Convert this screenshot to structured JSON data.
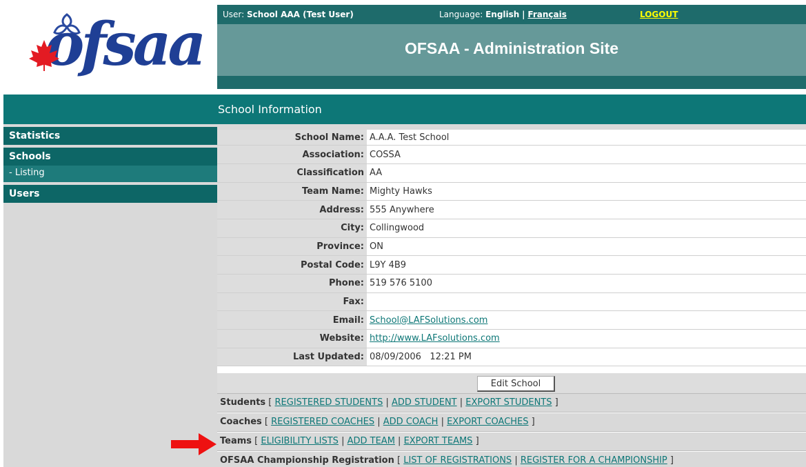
{
  "header": {
    "user_label": "User:",
    "user_name": "School AAA (Test User)",
    "language_label": "Language:",
    "language_current": "English",
    "language_sep": "|",
    "language_alt": "Français",
    "logout": "LOGOUT",
    "site_title": "OFSAA - Administration Site"
  },
  "logo": {
    "text": "ofsaa"
  },
  "section": {
    "title": "School Information"
  },
  "sidebar": {
    "statistics": "Statistics",
    "schools": "Schools",
    "listing": " - Listing",
    "users": "Users"
  },
  "school": {
    "name_label": "School Name:",
    "name": "A.A.A. Test School",
    "association_label": "Association:",
    "association": "COSSA",
    "classification_label": "Classification",
    "classification": "AA",
    "team_label": "Team Name:",
    "team": "Mighty Hawks",
    "address_label": "Address:",
    "address": "555 Anywhere",
    "city_label": "City:",
    "city": "Collingwood",
    "province_label": "Province:",
    "province": "ON",
    "postal_label": "Postal Code:",
    "postal": "L9Y 4B9",
    "phone_label": "Phone:",
    "phone": "519 576 5100",
    "fax_label": "Fax:",
    "fax": "",
    "email_label": "Email:",
    "email": "School@LAFSolutions.com",
    "website_label": "Website:",
    "website": "http://www.LAFsolutions.com",
    "updated_label": "Last Updated:",
    "updated": "08/09/2006   12:21 PM",
    "edit_button": "Edit School"
  },
  "links": {
    "students_label": "Students",
    "registered_students": "REGISTERED STUDENTS",
    "add_student": "ADD STUDENT",
    "export_students": "EXPORT STUDENTS",
    "coaches_label": "Coaches",
    "registered_coaches": "REGISTERED COACHES",
    "add_coach": "ADD COACH",
    "export_coaches": "EXPORT COACHES",
    "teams_label": "Teams",
    "eligibility_lists": "ELIGIBILITY LISTS",
    "add_team": "ADD TEAM",
    "export_teams": "EXPORT TEAMS",
    "championship_label": "OFSAA Championship Registration",
    "list_registrations": "LIST OF REGISTRATIONS",
    "register_championship": "REGISTER FOR A CHAMPIONSHIP"
  },
  "colors": {
    "teal_dark": "#0d6666",
    "teal_header": "#669999",
    "arrow": "#ee1111",
    "logo_blue": "#1f3f95"
  }
}
